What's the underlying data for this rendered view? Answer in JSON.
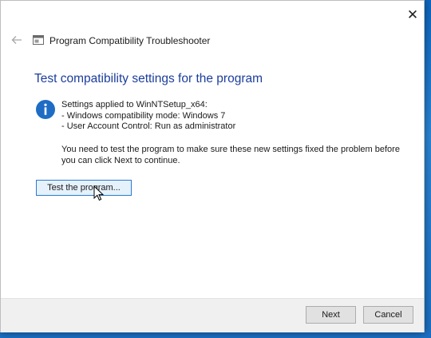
{
  "window": {
    "close_glyph": "✕"
  },
  "navbar": {
    "title": "Program Compatibility Troubleshooter",
    "back_icon": "back-arrow-icon",
    "app_icon": "troubleshooter-icon"
  },
  "main": {
    "heading": "Test compatibility settings for the program",
    "info_icon": "info-icon",
    "settings_lines": [
      "Settings applied to WinNTSetup_x64:",
      "- Windows compatibility mode: Windows 7",
      "- User Account Control:  Run as administrator"
    ],
    "note_lines": [
      "You need to test the program to make sure these new settings fixed the problem before",
      "you can click Next to continue."
    ],
    "test_button_label": "Test the program..."
  },
  "footer": {
    "next_label": "Next",
    "cancel_label": "Cancel"
  },
  "colors": {
    "heading": "#1c3d9c",
    "info_icon": "#1e6cc4",
    "accent_border": "#2a7bd1",
    "desktop": "#1c74c2"
  }
}
